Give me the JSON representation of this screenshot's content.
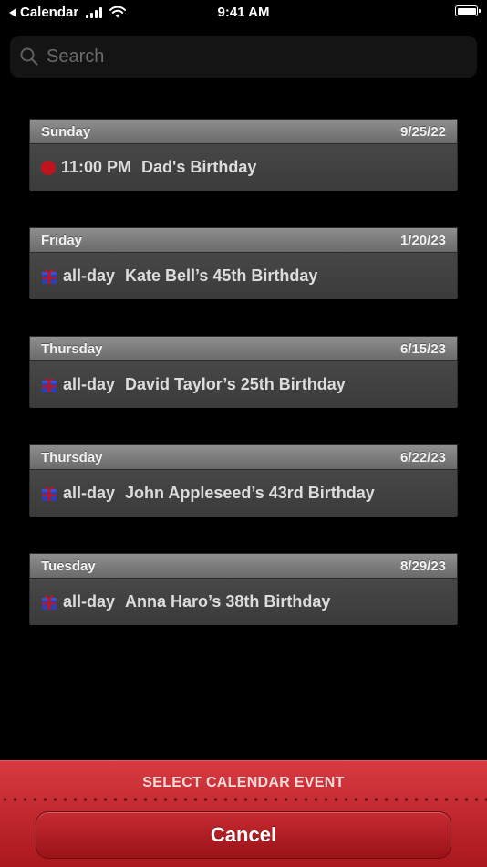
{
  "status_bar": {
    "back_app": "Calendar",
    "time": "9:41 AM"
  },
  "search": {
    "placeholder": "Search"
  },
  "events": [
    {
      "day": "Sunday",
      "date": "9/25/22",
      "time": "11:00 PM",
      "title": "Dad's Birthday",
      "icon": "red-dot-icon"
    },
    {
      "day": "Friday",
      "date": "1/20/23",
      "time": "all-day",
      "title": "Kate Bell’s 45th Birthday",
      "icon": "gift-icon"
    },
    {
      "day": "Thursday",
      "date": "6/15/23",
      "time": "all-day",
      "title": "David Taylor’s 25th Birthday",
      "icon": "gift-icon"
    },
    {
      "day": "Thursday",
      "date": "6/22/23",
      "time": "all-day",
      "title": "John Appleseed’s 43rd Birthday",
      "icon": "gift-icon"
    },
    {
      "day": "Tuesday",
      "date": "8/29/23",
      "time": "all-day",
      "title": "Anna Haro’s 38th Birthday",
      "icon": "gift-icon"
    }
  ],
  "action_sheet": {
    "title": "SELECT CALENDAR EVENT",
    "cancel_label": "Cancel"
  },
  "colors": {
    "accent_red": "#c0141c",
    "sheet_red": "#d83a41"
  }
}
